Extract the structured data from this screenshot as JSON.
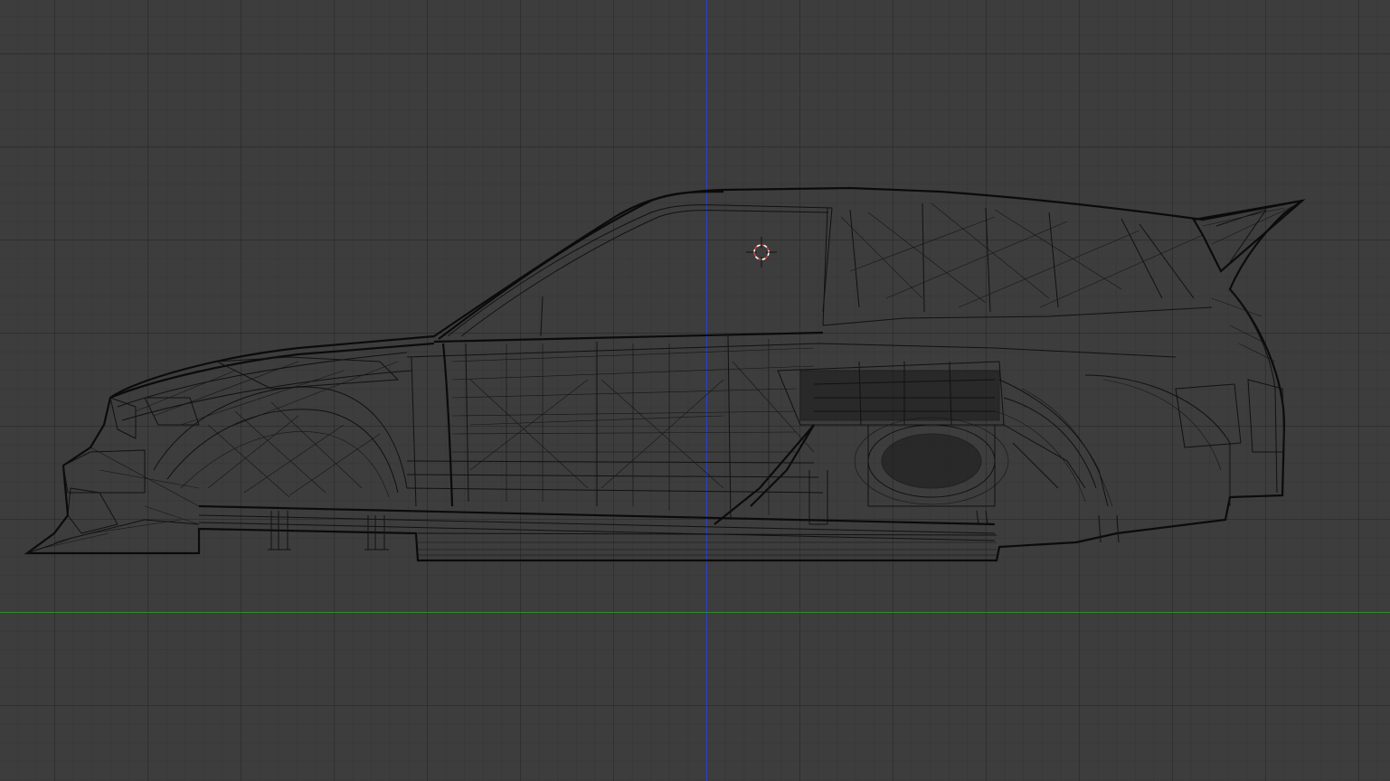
{
  "viewport": {
    "mode": "wireframe",
    "view": "side",
    "object": "car-body-mesh",
    "colors": {
      "background": "#3d3d3d",
      "wireframe": "#111111",
      "z_axis": "#2b3fd0",
      "y_axis": "#2f8a2f",
      "cursor_red": "#d83a3a",
      "cursor_white": "#ffffff"
    },
    "icons": {
      "cursor": "3d-cursor-icon"
    }
  }
}
